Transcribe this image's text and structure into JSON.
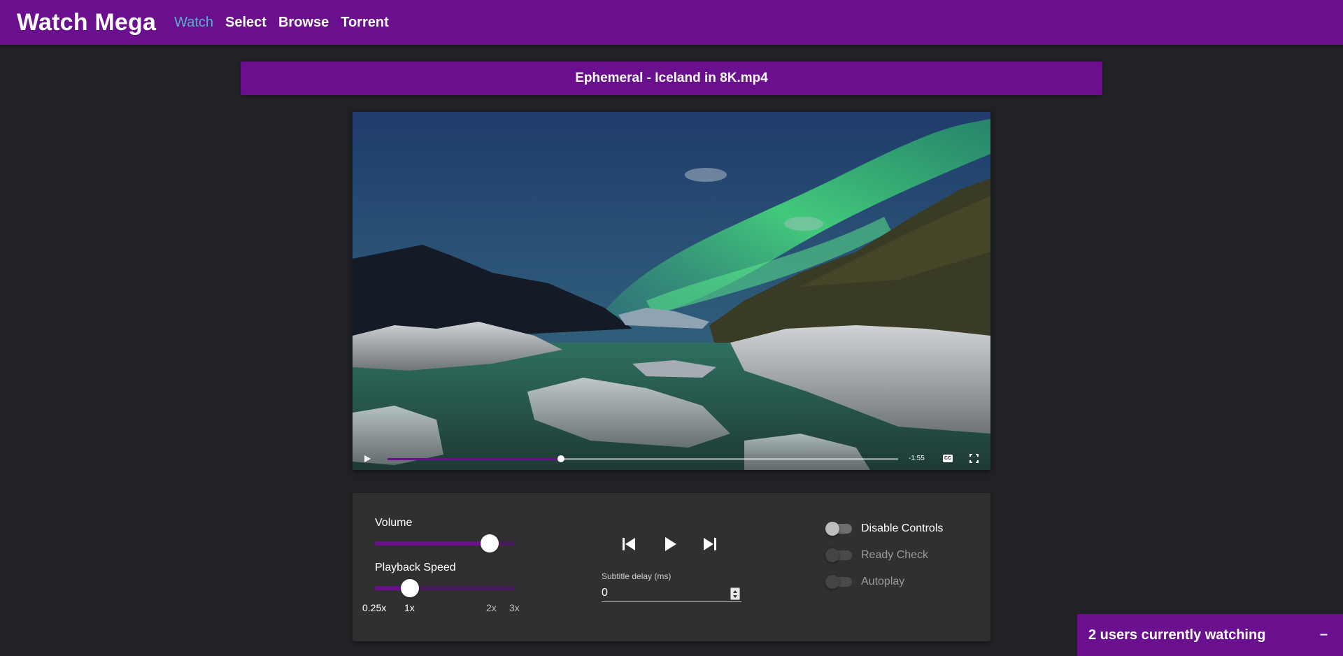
{
  "app": {
    "brand": "Watch Mega",
    "nav": [
      {
        "label": "Watch",
        "active": true
      },
      {
        "label": "Select",
        "active": false
      },
      {
        "label": "Browse",
        "active": false
      },
      {
        "label": "Torrent",
        "active": false
      }
    ]
  },
  "video": {
    "title": "Ephemeral - Iceland in 8K.mp4",
    "time_remaining": "-1:55",
    "progress_fraction": 0.34,
    "cc_label": "CC"
  },
  "controls": {
    "volume": {
      "label": "Volume",
      "value_fraction": 0.82
    },
    "playback_speed": {
      "label": "Playback Speed",
      "value_fraction": 0.25,
      "ticks": [
        "0.25x",
        "1x",
        "2x",
        "3x"
      ]
    },
    "subtitle_delay": {
      "label": "Subtitle delay (ms)",
      "value": "0"
    },
    "toggles": [
      {
        "label": "Disable Controls",
        "enabled": true
      },
      {
        "label": "Ready Check",
        "enabled": false
      },
      {
        "label": "Autoplay",
        "enabled": false
      }
    ]
  },
  "watching": {
    "text": "2 users currently watching",
    "minimize": "–"
  },
  "colors": {
    "primary": "#6a0f8e",
    "background": "#202225",
    "panel": "#303030",
    "nav_active": "#4fb3c9"
  },
  "icons": {
    "prev": "skip-previous-icon",
    "play": "play-icon",
    "next": "skip-next-icon",
    "fullscreen": "fullscreen-icon"
  }
}
